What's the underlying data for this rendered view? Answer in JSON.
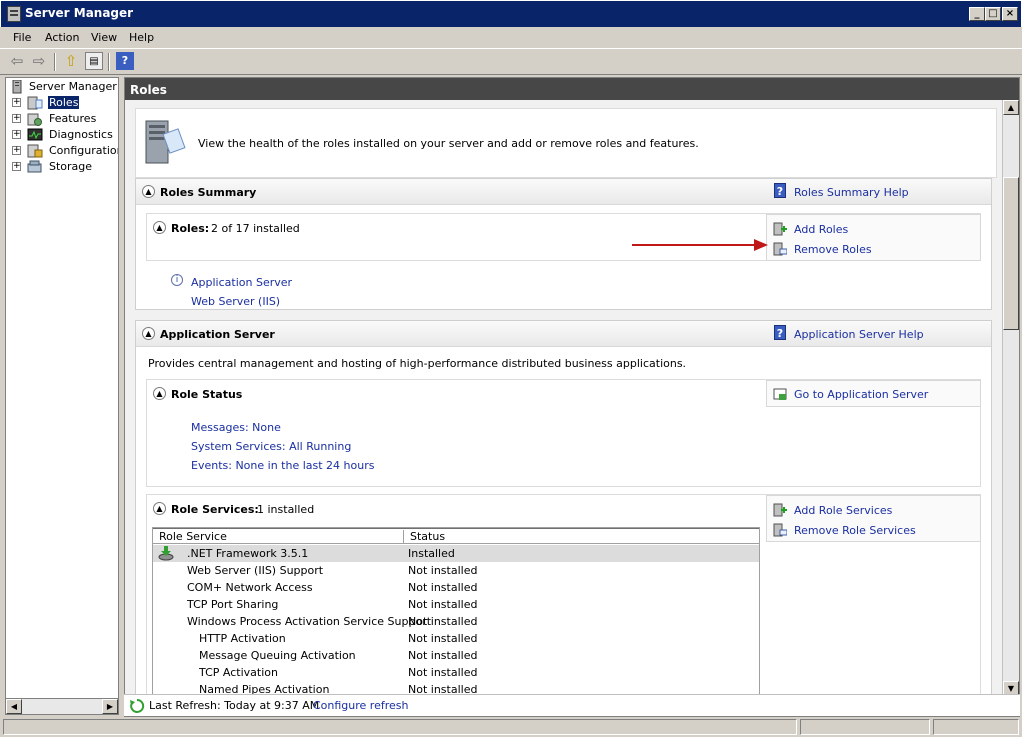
{
  "window": {
    "title": "Server Manager"
  },
  "menu": [
    "File",
    "Action",
    "View",
    "Help"
  ],
  "tree": {
    "root": "Server Manager (E",
    "items": [
      {
        "label": "Roles",
        "selected": true,
        "icon": "roles-icon"
      },
      {
        "label": "Features",
        "selected": false,
        "icon": "features-icon"
      },
      {
        "label": "Diagnostics",
        "selected": false,
        "icon": "diagnostics-icon"
      },
      {
        "label": "Configuration",
        "selected": false,
        "icon": "configuration-icon"
      },
      {
        "label": "Storage",
        "selected": false,
        "icon": "storage-icon"
      }
    ]
  },
  "pane": {
    "header": "Roles",
    "intro": "View the health of the roles installed on your server and add or remove roles and features."
  },
  "roles_summary": {
    "title": "Roles Summary",
    "help": "Roles Summary Help",
    "roles_label": "Roles:",
    "roles_count": "2 of 17 installed",
    "installed": [
      "Application Server",
      "Web Server (IIS)"
    ],
    "add_roles": "Add Roles",
    "remove_roles": "Remove Roles"
  },
  "app_server": {
    "title": "Application Server",
    "help": "Application Server Help",
    "description": "Provides central management and hosting of high-performance distributed business applications.",
    "role_status_title": "Role Status",
    "go_to": "Go to Application Server",
    "status_links": [
      "Messages: None",
      "System Services: All Running",
      "Events: None in the last 24 hours"
    ],
    "role_services_label": "Role Services:",
    "role_services_count": "1 installed",
    "add_role_services": "Add Role Services",
    "remove_role_services": "Remove Role Services",
    "table": {
      "headers": [
        "Role Service",
        "Status"
      ],
      "rows": [
        {
          "service": ".NET Framework 3.5.1",
          "status": "Installed",
          "indent": 0
        },
        {
          "service": "Web Server (IIS) Support",
          "status": "Not installed",
          "indent": 0
        },
        {
          "service": "COM+ Network Access",
          "status": "Not installed",
          "indent": 0
        },
        {
          "service": "TCP Port Sharing",
          "status": "Not installed",
          "indent": 0
        },
        {
          "service": "Windows Process Activation Service Support",
          "status": "Not installed",
          "indent": 0
        },
        {
          "service": "HTTP Activation",
          "status": "Not installed",
          "indent": 1
        },
        {
          "service": "Message Queuing Activation",
          "status": "Not installed",
          "indent": 1
        },
        {
          "service": "TCP Activation",
          "status": "Not installed",
          "indent": 1
        },
        {
          "service": "Named Pipes Activation",
          "status": "Not installed",
          "indent": 1
        }
      ]
    }
  },
  "refresh": {
    "text": "Last Refresh: Today at 9:37 AM",
    "configure": "Configure refresh"
  },
  "colors": {
    "titlebar": "#0a246a",
    "link": "#1a2fa0",
    "arrow": "#c01818",
    "pane_header": "#474747"
  }
}
